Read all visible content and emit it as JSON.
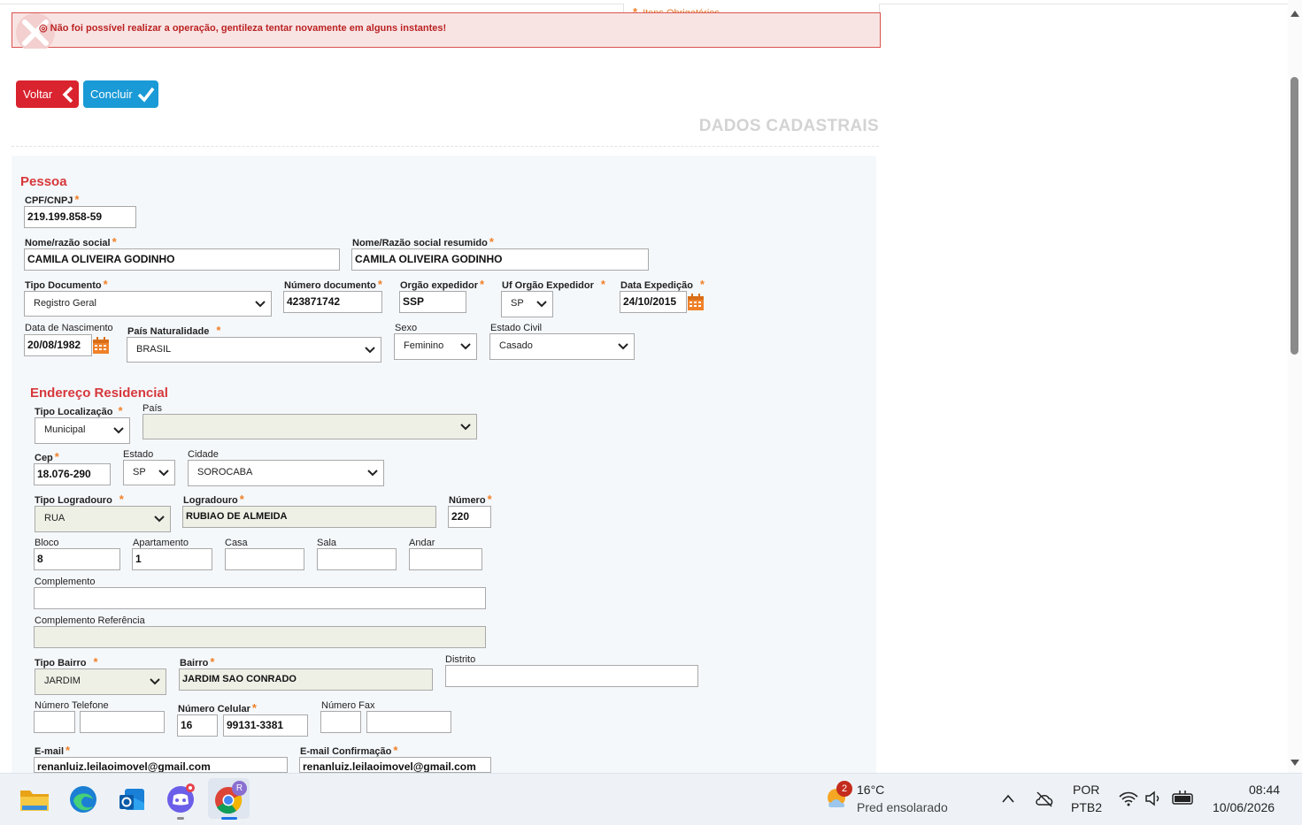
{
  "header": {
    "required_note": "Itens Obrigatórios",
    "error_message": "Não foi possível realizar a operação, gentileza tentar novamente em alguns instantes!"
  },
  "actions": {
    "back_label": "Voltar",
    "finish_label": "Concluir"
  },
  "section_title": "DADOS CADASTRAIS",
  "pessoa": {
    "title": "Pessoa",
    "cpf_label": "CPF/CNPJ",
    "cpf_value": "219.199.858-59",
    "nome_label": "Nome/razão social",
    "nome_value": "CAMILA OLIVEIRA GODINHO",
    "nome_resumido_label": "Nome/Razão social resumido",
    "nome_resumido_value": "CAMILA OLIVEIRA GODINHO",
    "tipo_doc_label": "Tipo Documento",
    "tipo_doc_value": "Registro Geral",
    "num_doc_label": "Número documento",
    "num_doc_value": "423871742",
    "orgao_label": "Orgão expedidor",
    "orgao_value": "SSP",
    "uf_orgao_label": "Uf Orgão Expedidor",
    "uf_orgao_value": "SP",
    "data_exp_label": "Data Expedição",
    "data_exp_value": "24/10/2015",
    "nascimento_label": "Data de Nascimento",
    "nascimento_value": "20/08/1982",
    "pais_nat_label": "País Naturalidade",
    "pais_nat_value": "BRASIL",
    "sexo_label": "Sexo",
    "sexo_value": "Feminino",
    "estado_civil_label": "Estado Civil",
    "estado_civil_value": "Casado"
  },
  "endereco": {
    "title": "Endereço Residencial",
    "tipo_loc_label": "Tipo Localização",
    "tipo_loc_value": "Municipal",
    "pais_label": "País",
    "pais_value": "",
    "cep_label": "Cep",
    "cep_value": "18.076-290",
    "estado_label": "Estado",
    "estado_value": "SP",
    "cidade_label": "Cidade",
    "cidade_value": "SOROCABA",
    "tipo_logr_label": "Tipo Logradouro",
    "tipo_logr_value": "RUA",
    "logr_label": "Logradouro",
    "logr_value": "RUBIAO DE ALMEIDA",
    "numero_label": "Número",
    "numero_value": "220",
    "bloco_label": "Bloco",
    "bloco_value": "8",
    "apto_label": "Apartamento",
    "apto_value": "1",
    "casa_label": "Casa",
    "casa_value": "",
    "sala_label": "Sala",
    "sala_value": "",
    "andar_label": "Andar",
    "andar_value": "",
    "compl_label": "Complemento",
    "compl_value": "",
    "compl_ref_label": "Complemento Referência",
    "compl_ref_value": "",
    "tipo_bairro_label": "Tipo Bairro",
    "tipo_bairro_value": "JARDIM",
    "bairro_label": "Bairro",
    "bairro_value": "JARDIM SAO CONRADO",
    "distrito_label": "Distrito",
    "distrito_value": "",
    "tel_label": "Número Telefone",
    "tel_ddd": "",
    "tel_num": "",
    "cel_label": "Número Celular",
    "cel_ddd": "16",
    "cel_num": "99131-3381",
    "fax_label": "Número Fax",
    "fax_ddd": "",
    "fax_num": "",
    "email_label": "E-mail",
    "email_value": "renanluiz.leilaoimovel@gmail.com",
    "email_conf_label": "E-mail Confirmação",
    "email_conf_value": "renanluiz.leilaoimovel@gmail.com"
  },
  "taskbar": {
    "weather_badge": "2",
    "weather_temp": "16°C",
    "weather_desc": "Pred ensolarado",
    "lang": "POR",
    "layout": "PTB2",
    "time": "08:44",
    "date": "10/06/2026",
    "chrome_profile": "R"
  },
  "colors": {
    "danger": "#d9232e",
    "primary": "#1a9ad6",
    "required": "#f0812a",
    "section": "#d6373a"
  }
}
